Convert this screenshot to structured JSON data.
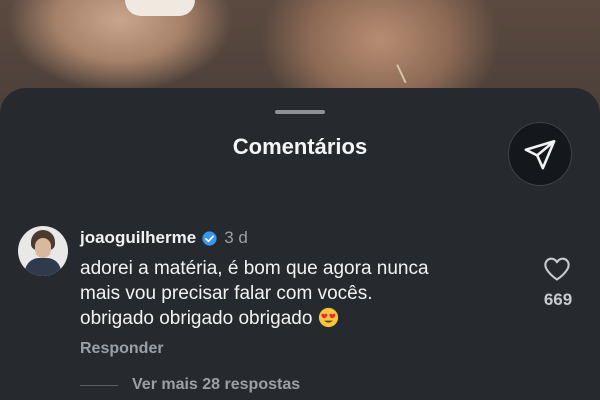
{
  "sheet": {
    "title": "Comentários"
  },
  "comment": {
    "username": "joaoguilherme",
    "verified": true,
    "time": "3 d",
    "text_line1": "adorei a matéria, é bom que agora nunca",
    "text_line2": "mais vou precisar falar com vocês.",
    "text_line3": "obrigado obrigado obrigado",
    "emoji": "heart-eyes-emoji",
    "like_count": "669",
    "reply_label": "Responder",
    "view_more_label": "Ver mais 28 respostas"
  },
  "colors": {
    "sheet_bg": "#262a2f",
    "verified_blue": "#3897f0",
    "secondary_text": "#9aa0a6"
  },
  "icons": {
    "share": "send-icon",
    "like": "heart-outline-icon",
    "verified": "verified-badge-icon"
  }
}
